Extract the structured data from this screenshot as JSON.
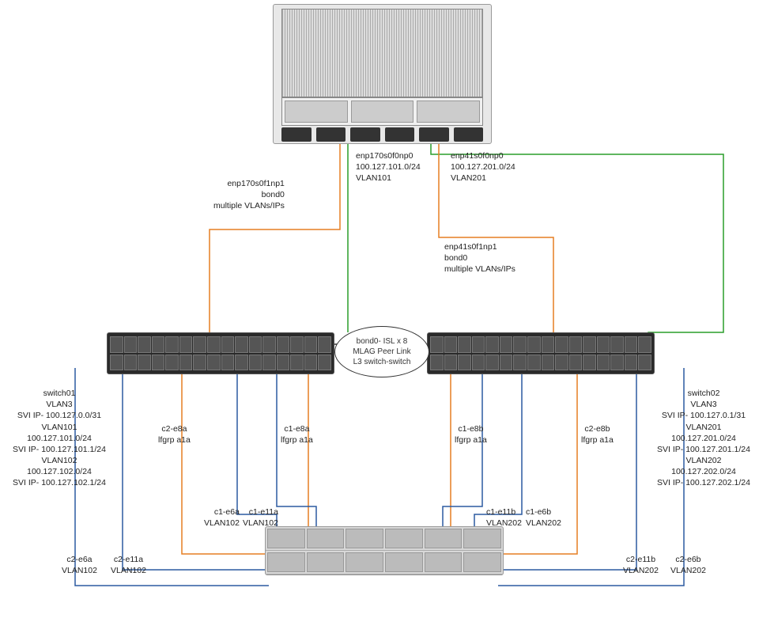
{
  "chart_data": {
    "type": "diagram",
    "title": "Network connectivity diagram — server, two switches (MLAG), dual-controller storage",
    "nodes": [
      {
        "id": "server",
        "type": "server"
      },
      {
        "id": "switch01",
        "type": "switch"
      },
      {
        "id": "switch02",
        "type": "switch"
      },
      {
        "id": "storage",
        "type": "storage",
        "controllers": [
          "c1",
          "c2"
        ]
      }
    ],
    "isl": {
      "label": "bond0- ISL x 8",
      "desc1": "MLAG Peer Link",
      "desc2": "L3 switch-switch"
    },
    "server_interfaces": {
      "enp170s0f0np0": {
        "subnet": "100.127.101.0/24",
        "vlan": "VLAN101",
        "to": "switch01"
      },
      "enp170s0f1np1": {
        "bond": "bond0",
        "note": "multiple VLANs/IPs",
        "to": "switch01"
      },
      "enp41s0f0np0": {
        "subnet": "100.127.201.0/24",
        "vlan": "VLAN201",
        "to": "switch02"
      },
      "enp41s0f1np1": {
        "bond": "bond0",
        "note": "multiple VLANs/IPs",
        "to": "switch02"
      }
    },
    "switch01": {
      "name": "switch01",
      "vlan_peer": "VLAN3",
      "svi_peer": "SVI IP- 100.127.0.0/31",
      "vlans": [
        {
          "vlan": "VLAN101",
          "subnet": "100.127.101.0/24",
          "svi": "SVI IP- 100.127.101.1/24"
        },
        {
          "vlan": "VLAN102",
          "subnet": "100.127.102.0/24",
          "svi": "SVI IP- 100.127.102.1/24"
        }
      ]
    },
    "switch02": {
      "name": "switch02",
      "vlan_peer": "VLAN3",
      "svi_peer": "SVI IP- 100.127.0.1/31",
      "vlans": [
        {
          "vlan": "VLAN201",
          "subnet": "100.127.201.0/24",
          "svi": "SVI IP- 100.127.201.1/24"
        },
        {
          "vlan": "VLAN202",
          "subnet": "100.127.202.0/24",
          "svi": "SVI IP- 100.127.202.1/24"
        }
      ]
    },
    "storage_links": {
      "switch01": [
        {
          "port": "c2-e8a",
          "grp": "lfgrp a1a"
        },
        {
          "port": "c1-e8a",
          "grp": "lfgrp a1a"
        },
        {
          "port": "c1-e6a",
          "vlan": "VLAN102"
        },
        {
          "port": "c1-e11a",
          "vlan": "VLAN102"
        },
        {
          "port": "c2-e6a",
          "vlan": "VLAN102"
        },
        {
          "port": "c2-e11a",
          "vlan": "VLAN102"
        }
      ],
      "switch02": [
        {
          "port": "c1-e8b",
          "grp": "lfgrp a1a"
        },
        {
          "port": "c2-e8b",
          "grp": "lfgrp a1a"
        },
        {
          "port": "c1-e11b",
          "vlan": "VLAN202"
        },
        {
          "port": "c1-e6b",
          "vlan": "VLAN202"
        },
        {
          "port": "c2-e11b",
          "vlan": "VLAN202"
        },
        {
          "port": "c2-e6b",
          "vlan": "VLAN202"
        }
      ]
    }
  },
  "labels": {
    "enp170_0": {
      "l1": "enp170s0f0np0",
      "l2": "100.127.101.0/24",
      "l3": "VLAN101"
    },
    "enp170_1": {
      "l1": "enp170s0f1np1",
      "l2": "bond0",
      "l3": "multiple VLANs/IPs"
    },
    "enp41_0": {
      "l1": "enp41s0f0np0",
      "l2": "100.127.201.0/24",
      "l3": "VLAN201"
    },
    "enp41_1": {
      "l1": "enp41s0f1np1",
      "l2": "bond0",
      "l3": "multiple VLANs/IPs"
    },
    "isl": {
      "l1": "bond0- ISL x 8",
      "l2": "MLAG Peer Link",
      "l3": "L3 switch-switch"
    },
    "sw01": {
      "l1": "switch01",
      "l2": "VLAN3",
      "l3": "SVI IP- 100.127.0.0/31",
      "l4": "VLAN101",
      "l5": "100.127.101.0/24",
      "l6": "SVI IP- 100.127.101.1/24",
      "l7": "VLAN102",
      "l8": "100.127.102.0/24",
      "l9": "SVI IP- 100.127.102.1/24"
    },
    "sw02": {
      "l1": "switch02",
      "l2": "VLAN3",
      "l3": "SVI IP- 100.127.0.1/31",
      "l4": "VLAN201",
      "l5": "100.127.201.0/24",
      "l6": "SVI IP- 100.127.201.1/24",
      "l7": "VLAN202",
      "l8": "100.127.202.0/24",
      "l9": "SVI IP- 100.127.202.1/24"
    },
    "c2e8a": {
      "l1": "c2-e8a",
      "l2": "lfgrp a1a"
    },
    "c1e8a": {
      "l1": "c1-e8a",
      "l2": "lfgrp a1a"
    },
    "c1e8b": {
      "l1": "c1-e8b",
      "l2": "lfgrp a1a"
    },
    "c2e8b": {
      "l1": "c2-e8b",
      "l2": "lfgrp a1a"
    },
    "c1e6a": {
      "l1": "c1-e6a",
      "l2": "VLAN102"
    },
    "c1e11a": {
      "l1": "c1-e11a",
      "l2": "VLAN102"
    },
    "c1e11b": {
      "l1": "c1-e11b",
      "l2": "VLAN202"
    },
    "c1e6b": {
      "l1": "c1-e6b",
      "l2": "VLAN202"
    },
    "c2e6a": {
      "l1": "c2-e6a",
      "l2": "VLAN102"
    },
    "c2e11a": {
      "l1": "c2-e11a",
      "l2": "VLAN102"
    },
    "c2e11b": {
      "l1": "c2-e11b",
      "l2": "VLAN202"
    },
    "c2e6b": {
      "l1": "c2-e6b",
      "l2": "VLAN202"
    }
  }
}
